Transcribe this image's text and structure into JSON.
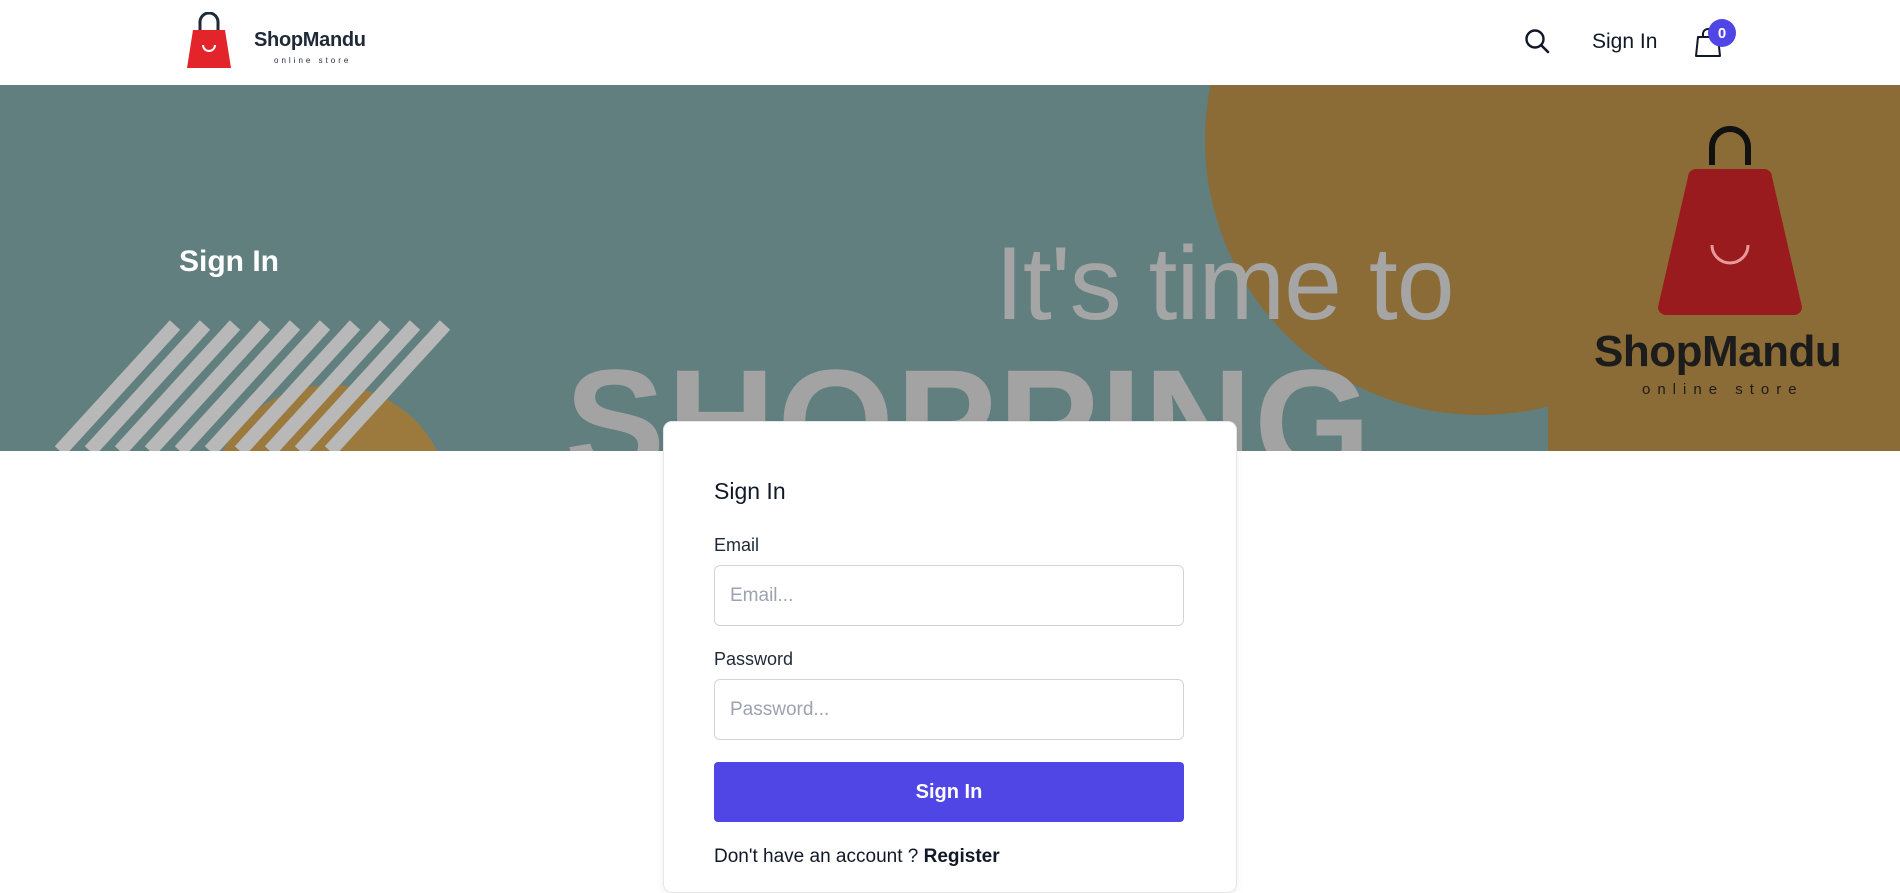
{
  "header": {
    "logo_name": "ShopMandu",
    "logo_tag": "online store",
    "sign_in_label": "Sign In",
    "cart_count": "0"
  },
  "hero": {
    "title": "Sign In",
    "banner_line1": "It's time to",
    "banner_line2": "SHOPPING",
    "banner_brand": "ShopMandu",
    "banner_brand_tag": "online store"
  },
  "form": {
    "title": "Sign In",
    "email_label": "Email",
    "email_placeholder": "Email...",
    "email_value": "",
    "password_label": "Password",
    "password_placeholder": "Password...",
    "password_value": "",
    "submit_label": "Sign In",
    "register_prompt": "Don't have an account ? ",
    "register_link": "Register"
  },
  "colors": {
    "accent": "#4f46e5",
    "brand_red": "#e3242b",
    "banner_teal": "#627f80",
    "banner_gold": "#8b6b36"
  },
  "icons": [
    "shopping-bag-logo-icon",
    "search-icon",
    "cart-bag-icon"
  ]
}
